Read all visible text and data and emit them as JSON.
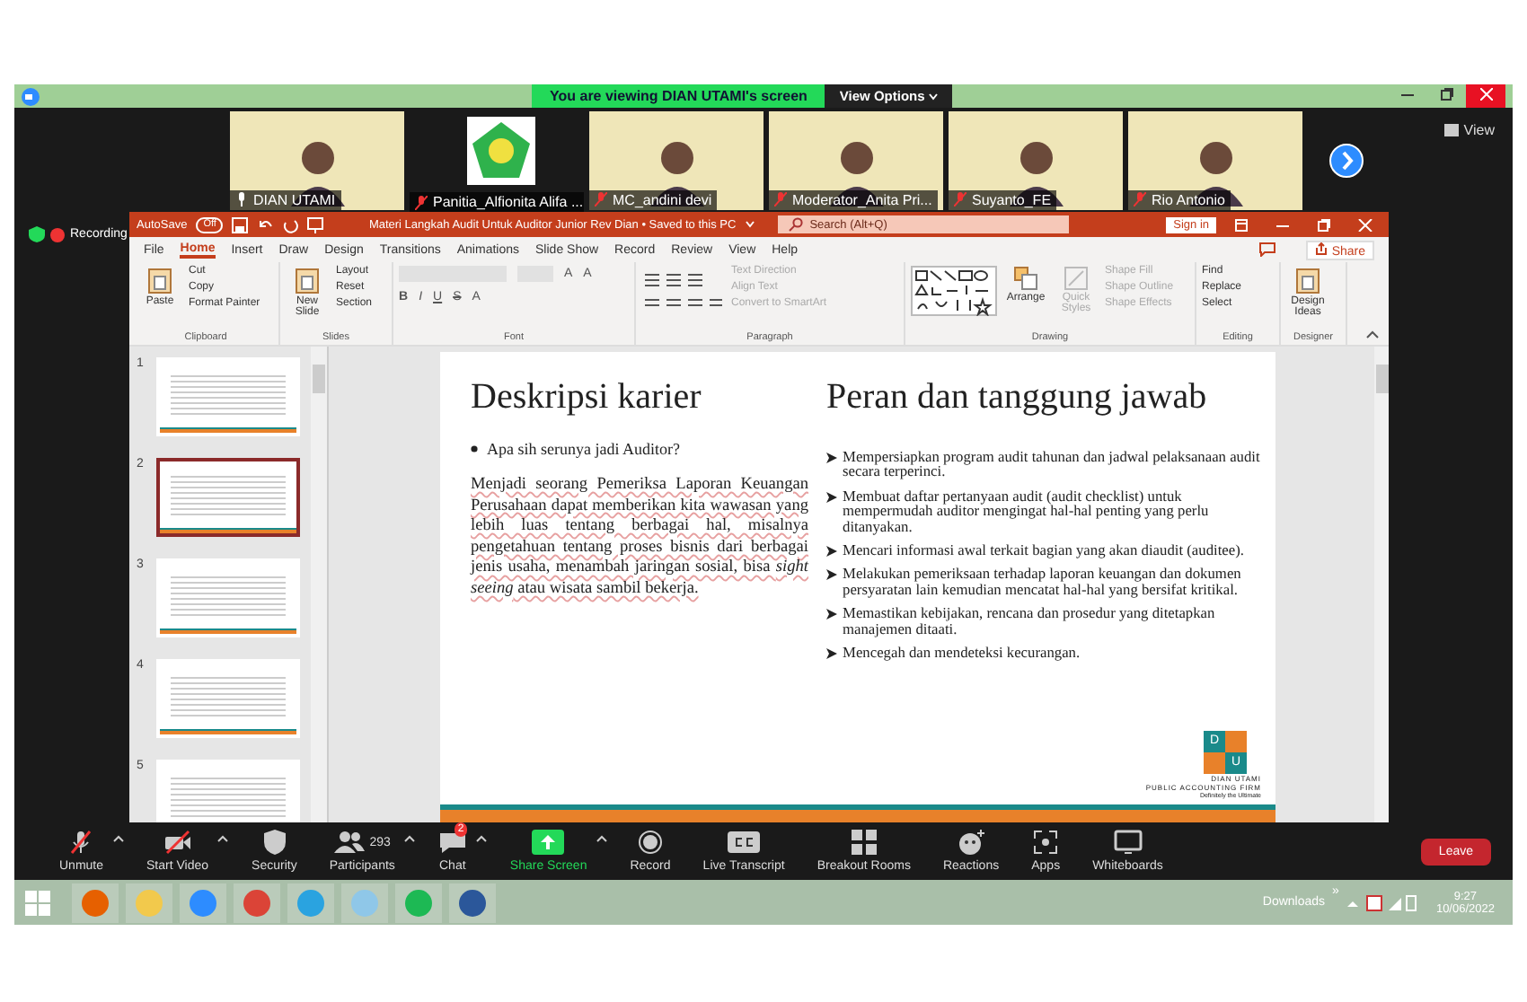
{
  "zoom_bar": {
    "banner": "You are viewing DIAN UTAMI's screen",
    "view_options": "View Options"
  },
  "participants": [
    {
      "name": "DIAN UTAMI",
      "kind": "video",
      "muted": false
    },
    {
      "name": "Panitia_Alfionita Alifa ...",
      "kind": "logo",
      "muted": true
    },
    {
      "name": "MC_andini devi",
      "kind": "video",
      "muted": true
    },
    {
      "name": "Moderator_Anita Pri...",
      "kind": "video",
      "muted": true
    },
    {
      "name": "Suyanto_FE",
      "kind": "video",
      "muted": true
    },
    {
      "name": "Rio Antonio",
      "kind": "video",
      "muted": true
    }
  ],
  "view_label": "View",
  "recording": "Recording",
  "ppt": {
    "autosave": "AutoSave",
    "autosave_state": "Off",
    "autosave_on": false,
    "title": "Materi Langkah Audit Untuk Auditor Junior Rev Dian • Saved to this PC",
    "search_placeholder": "Search (Alt+Q)",
    "sign_in": "Sign in",
    "share": "Share",
    "tabs": [
      {
        "label": "File",
        "selected": false
      },
      {
        "label": "Home",
        "selected": true
      },
      {
        "label": "Insert",
        "selected": false
      },
      {
        "label": "Draw",
        "selected": false
      },
      {
        "label": "Design",
        "selected": false
      },
      {
        "label": "Transitions",
        "selected": false
      },
      {
        "label": "Animations",
        "selected": false
      },
      {
        "label": "Slide Show",
        "selected": false
      },
      {
        "label": "Record",
        "selected": false
      },
      {
        "label": "Review",
        "selected": false
      },
      {
        "label": "View",
        "selected": false
      },
      {
        "label": "Help",
        "selected": false
      }
    ],
    "groups": [
      {
        "name": "Clipboard",
        "kind": "clipboard",
        "big": "Paste",
        "small": [
          {
            "label": "Cut",
            "disabled": false
          },
          {
            "label": "Copy",
            "disabled": false
          },
          {
            "label": "Format Painter",
            "disabled": false
          }
        ]
      },
      {
        "name": "Slides",
        "kind": "slides",
        "big": "New Slide",
        "small": [
          {
            "label": "Layout",
            "disabled": false
          },
          {
            "label": "Reset",
            "disabled": false
          },
          {
            "label": "Section",
            "disabled": false
          }
        ]
      },
      {
        "name": "Font",
        "kind": "font",
        "size_buttons": [
          "A",
          "A"
        ],
        "format_buttons": [
          "B",
          "I",
          "U",
          "S",
          "A"
        ]
      },
      {
        "name": "Paragraph",
        "kind": "paragraph",
        "small": [
          {
            "label": "Text Direction",
            "disabled": true
          },
          {
            "label": "Align Text",
            "disabled": true
          },
          {
            "label": "Convert to SmartArt",
            "disabled": true
          }
        ]
      },
      {
        "name": "Drawing",
        "kind": "drawing",
        "big": "Arrange",
        "big2": "Quick Styles",
        "small": [
          {
            "label": "Shape Fill",
            "disabled": true
          },
          {
            "label": "Shape Outline",
            "disabled": true
          },
          {
            "label": "Shape Effects",
            "disabled": true
          }
        ]
      },
      {
        "name": "Editing",
        "kind": "editing",
        "small": [
          {
            "label": "Find",
            "disabled": false
          },
          {
            "label": "Replace",
            "disabled": false
          },
          {
            "label": "Select",
            "disabled": false
          }
        ]
      },
      {
        "name": "Designer",
        "kind": "designer",
        "big": "Design Ideas"
      }
    ]
  },
  "thumbnails": [
    {
      "number": "1",
      "selected": false
    },
    {
      "number": "2",
      "selected": true
    },
    {
      "number": "3",
      "selected": false
    },
    {
      "number": "4",
      "selected": false
    },
    {
      "number": "5",
      "selected": false
    }
  ],
  "slide": {
    "left_title": "Deskripsi karier",
    "bullet": "Apa sih serunya jadi Auditor?",
    "paragraph": "Menjadi seorang Pemeriksa Laporan Keuangan Perusahaan dapat memberikan kita wawasan yang lebih luas tentang berbagai hal, misalnya pengetahuan tentang proses bisnis dari berbagai jenis usaha, menambah jaringan sosial, bisa *sight seeing* atau wisata sambil bekerja.",
    "right_title": "Peran dan tanggung jawab",
    "items": [
      "Mempersiapkan program audit tahunan dan jadwal pelaksanaan audit secara terperinci.",
      "Membuat daftar pertanyaan audit (audit checklist) untuk mempermudah auditor mengingat hal-hal penting yang perlu ditanyakan.",
      "Mencari informasi awal terkait bagian yang akan diaudit (auditee).",
      "Melakukan pemeriksaan terhadap laporan keuangan dan dokumen persyaratan lain kemudian mencatat hal-hal yang bersifat kritikal.",
      "Memastikan kebijakan, rencana dan prosedur yang ditetapkan manajemen ditaati.",
      "Mencegah dan mendeteksi kecurangan."
    ],
    "logo": {
      "letter_1": "D",
      "letter_2": "U",
      "firm": "DIAN UTAMI",
      "sub": "PUBLIC ACCOUNTING FIRM",
      "tagline": "Definitely the Ultimate"
    }
  },
  "toolbar": [
    {
      "label": "Unmute",
      "kind": "mic",
      "caret": true
    },
    {
      "label": "Start Video",
      "kind": "video",
      "caret": true
    },
    {
      "label": "Security",
      "kind": "shield",
      "caret": false
    },
    {
      "label": "Participants",
      "kind": "people",
      "count": "293",
      "caret": true
    },
    {
      "label": "Chat",
      "kind": "chat",
      "badge": "2",
      "caret": true
    },
    {
      "label": "Share Screen",
      "kind": "share",
      "caret": true
    },
    {
      "label": "Record",
      "kind": "record",
      "caret": false
    },
    {
      "label": "Live Transcript",
      "kind": "cc",
      "caret": false
    },
    {
      "label": "Breakout Rooms",
      "kind": "rooms",
      "caret": false
    },
    {
      "label": "Reactions",
      "kind": "smile",
      "caret": false
    },
    {
      "label": "Apps",
      "kind": "apps",
      "caret": false
    },
    {
      "label": "Whiteboards",
      "kind": "board",
      "caret": false
    }
  ],
  "leave": "Leave",
  "taskbar": {
    "apps": [
      {
        "kind": "firefox"
      },
      {
        "kind": "explorer"
      },
      {
        "kind": "zoom"
      },
      {
        "kind": "chrome"
      },
      {
        "kind": "telegram"
      },
      {
        "kind": "notepad"
      },
      {
        "kind": "spotify"
      },
      {
        "kind": "word"
      }
    ],
    "downloads": "Downloads",
    "chevron": "»",
    "time": "9:27",
    "date": "10/06/2022"
  }
}
